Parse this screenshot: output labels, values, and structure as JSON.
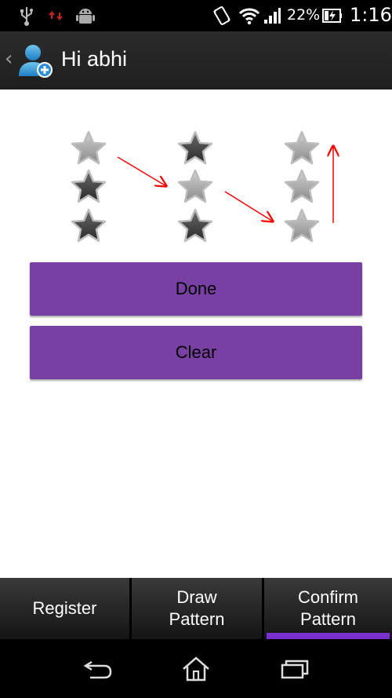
{
  "status_bar": {
    "left_icons": [
      "usb-icon",
      "sync-arrows-icon",
      "android-debug-icon"
    ],
    "right_icons": [
      "vibrate-icon",
      "wifi-icon",
      "signal-icon",
      "battery-charging-icon"
    ],
    "battery_percent": "22%",
    "time": "1:16"
  },
  "action_bar": {
    "title": "Hi abhi",
    "back_icon": "chevron-left-icon",
    "app_icon": "user-add-icon"
  },
  "pattern_grid": {
    "columns": 3,
    "rows": 3,
    "stars": [
      {
        "col": 0,
        "row": 0,
        "state": "light"
      },
      {
        "col": 1,
        "row": 0,
        "state": "dark"
      },
      {
        "col": 2,
        "row": 0,
        "state": "light"
      },
      {
        "col": 0,
        "row": 1,
        "state": "dark"
      },
      {
        "col": 1,
        "row": 1,
        "state": "light"
      },
      {
        "col": 2,
        "row": 1,
        "state": "light"
      },
      {
        "col": 0,
        "row": 2,
        "state": "dark"
      },
      {
        "col": 1,
        "row": 2,
        "state": "dark"
      },
      {
        "col": 2,
        "row": 2,
        "state": "light"
      }
    ],
    "arrow_color": "#ff0000"
  },
  "buttons": {
    "done_label": "Done",
    "clear_label": "Clear",
    "color": "#7940a3"
  },
  "tabs": [
    {
      "label": "Register",
      "selected": false
    },
    {
      "label": "Draw\nPattern",
      "selected": false
    },
    {
      "label": "Confirm\nPattern",
      "selected": true
    }
  ],
  "nav_bar": {
    "icons": [
      "back-icon",
      "home-icon",
      "recent-apps-icon"
    ]
  }
}
